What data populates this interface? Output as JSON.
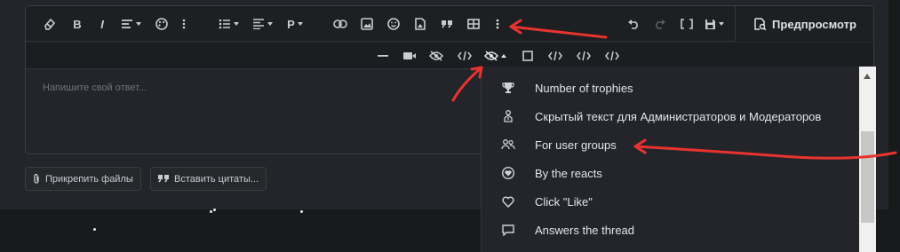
{
  "editor": {
    "placeholder": "Напишите свой ответ...",
    "preview_label": "Предпросмотр"
  },
  "toolbar_primary": [
    {
      "name": "eraser-icon"
    },
    {
      "name": "bold-icon",
      "text": "B"
    },
    {
      "name": "italic-icon",
      "text": "I"
    },
    {
      "name": "text-size-icon"
    },
    {
      "name": "palette-icon"
    },
    {
      "name": "more-vertical-icon"
    },
    {
      "name": "bulleted-list-icon"
    },
    {
      "name": "align-icon"
    },
    {
      "name": "paragraph-icon",
      "text": "P"
    },
    {
      "name": "link-icon"
    },
    {
      "name": "image-icon"
    },
    {
      "name": "smiley-icon"
    },
    {
      "name": "media-icon"
    },
    {
      "name": "quote-icon"
    },
    {
      "name": "table-icon"
    },
    {
      "name": "more-vertical-icon"
    },
    {
      "name": "undo-icon"
    },
    {
      "name": "redo-icon"
    },
    {
      "name": "bbcode-icon"
    },
    {
      "name": "save-icon"
    }
  ],
  "toolbar_secondary": [
    {
      "name": "horizontal-rule-icon"
    },
    {
      "name": "video-icon"
    },
    {
      "name": "hide-icon"
    },
    {
      "name": "code-icon"
    },
    {
      "name": "hide-dropdown-icon"
    },
    {
      "name": "square-icon"
    },
    {
      "name": "code-icon"
    },
    {
      "name": "code-icon"
    },
    {
      "name": "code-icon"
    }
  ],
  "actions": {
    "attach_files": "Прикрепить файлы",
    "insert_quotes": "Вставить цитаты..."
  },
  "dropdown": {
    "items": [
      {
        "icon": "trophy-icon",
        "label": "Number of trophies"
      },
      {
        "icon": "moderator-icon",
        "label": "Скрытый текст для Администраторов и Модераторов"
      },
      {
        "icon": "user-group-icon",
        "label": "For user groups"
      },
      {
        "icon": "heart-circle-icon",
        "label": "By the reacts"
      },
      {
        "icon": "heart-icon",
        "label": "Click \"Like\""
      },
      {
        "icon": "comment-icon",
        "label": "Answers the thread"
      }
    ]
  },
  "colors": {
    "background": "#191a1c",
    "panel": "#23252a",
    "toolbar": "#1d1f22",
    "annotation_arrow": "#e8332f"
  }
}
